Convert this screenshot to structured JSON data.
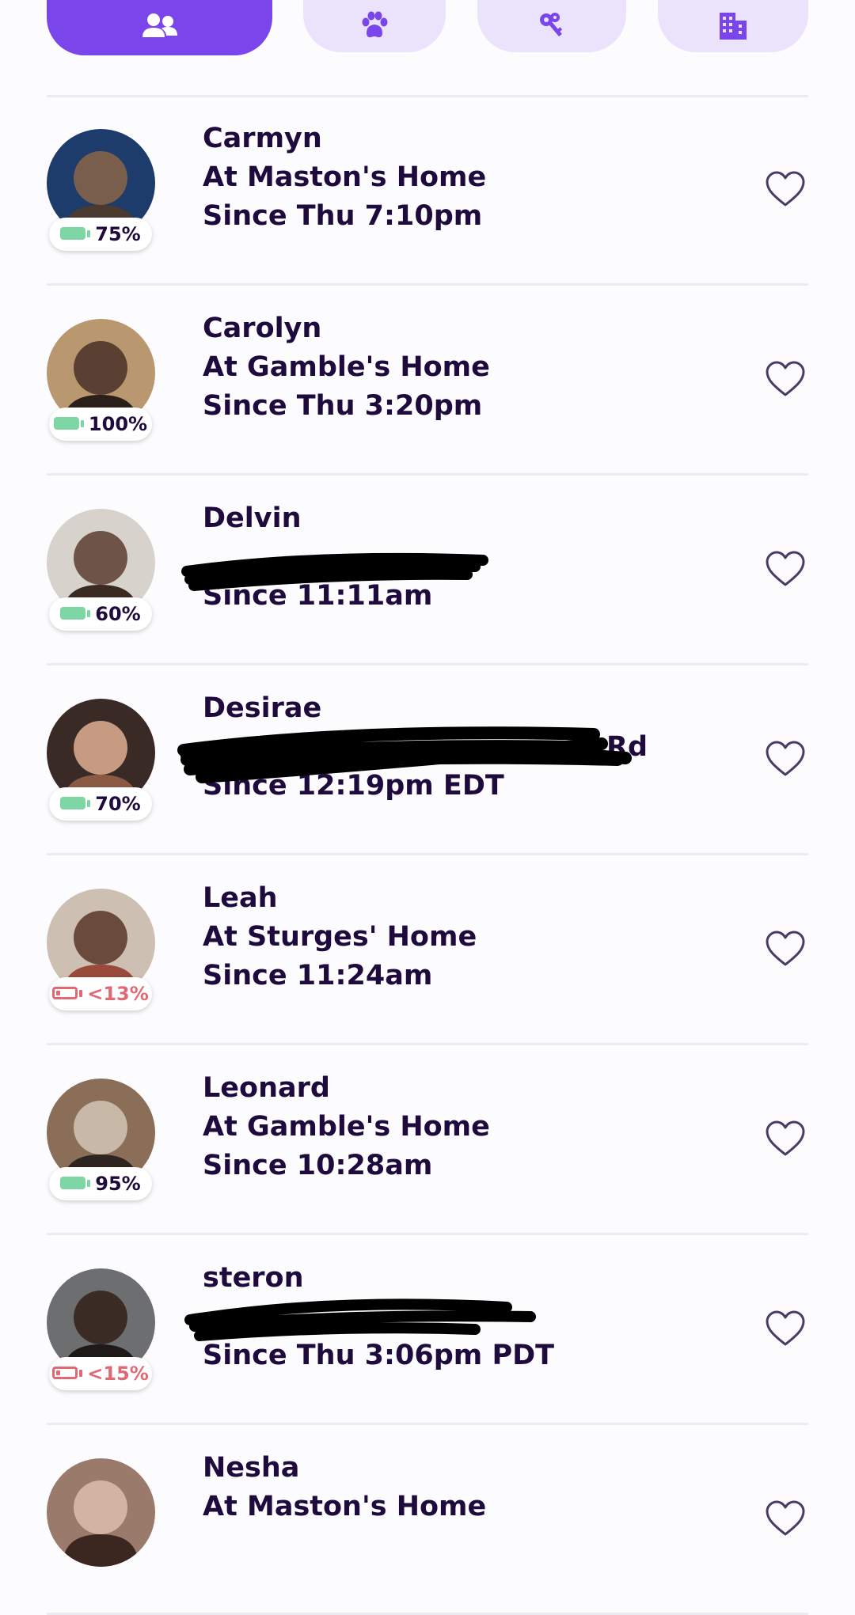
{
  "tabs": [
    {
      "name": "people-tab",
      "icon": "people-icon",
      "active": true
    },
    {
      "name": "pets-tab",
      "icon": "paw-icon",
      "active": false
    },
    {
      "name": "keys-tab",
      "icon": "keys-icon",
      "active": false
    },
    {
      "name": "buildings-tab",
      "icon": "building-icon",
      "active": false
    }
  ],
  "colors": {
    "accent": "#7a45ea",
    "tab_inactive": "#ebe3fb",
    "text": "#1e0a3c",
    "battery_good": "#7dd6a3",
    "battery_low": "#e06a74"
  },
  "people": [
    {
      "name": "Carmyn",
      "location": "At Maston's Home",
      "since": "Since Thu 7:10pm",
      "battery": "75%",
      "battery_low": false,
      "favorite": false
    },
    {
      "name": "Carolyn",
      "location": "At Gamble's Home",
      "since": "Since Thu 3:20pm",
      "battery": "100%",
      "battery_low": false,
      "favorite": false
    },
    {
      "name": "Delvin",
      "location": "",
      "since": "Since 11:11am",
      "battery": "60%",
      "battery_low": false,
      "favorite": false
    },
    {
      "name": "Desirae",
      "location": "Rd",
      "since": "Since 12:19pm EDT",
      "battery": "70%",
      "battery_low": false,
      "favorite": false
    },
    {
      "name": "Leah",
      "location": "At Sturges' Home",
      "since": "Since 11:24am",
      "battery": "<13%",
      "battery_low": true,
      "favorite": false
    },
    {
      "name": "Leonard",
      "location": "At Gamble's Home",
      "since": "Since 10:28am",
      "battery": "95%",
      "battery_low": false,
      "favorite": false
    },
    {
      "name": "steron",
      "location": "",
      "since": "Since Thu 3:06pm PDT",
      "battery": "<15%",
      "battery_low": true,
      "favorite": false
    },
    {
      "name": "Nesha",
      "location": "At Maston's Home",
      "since": "",
      "battery": "",
      "battery_low": false,
      "favorite": false
    }
  ]
}
